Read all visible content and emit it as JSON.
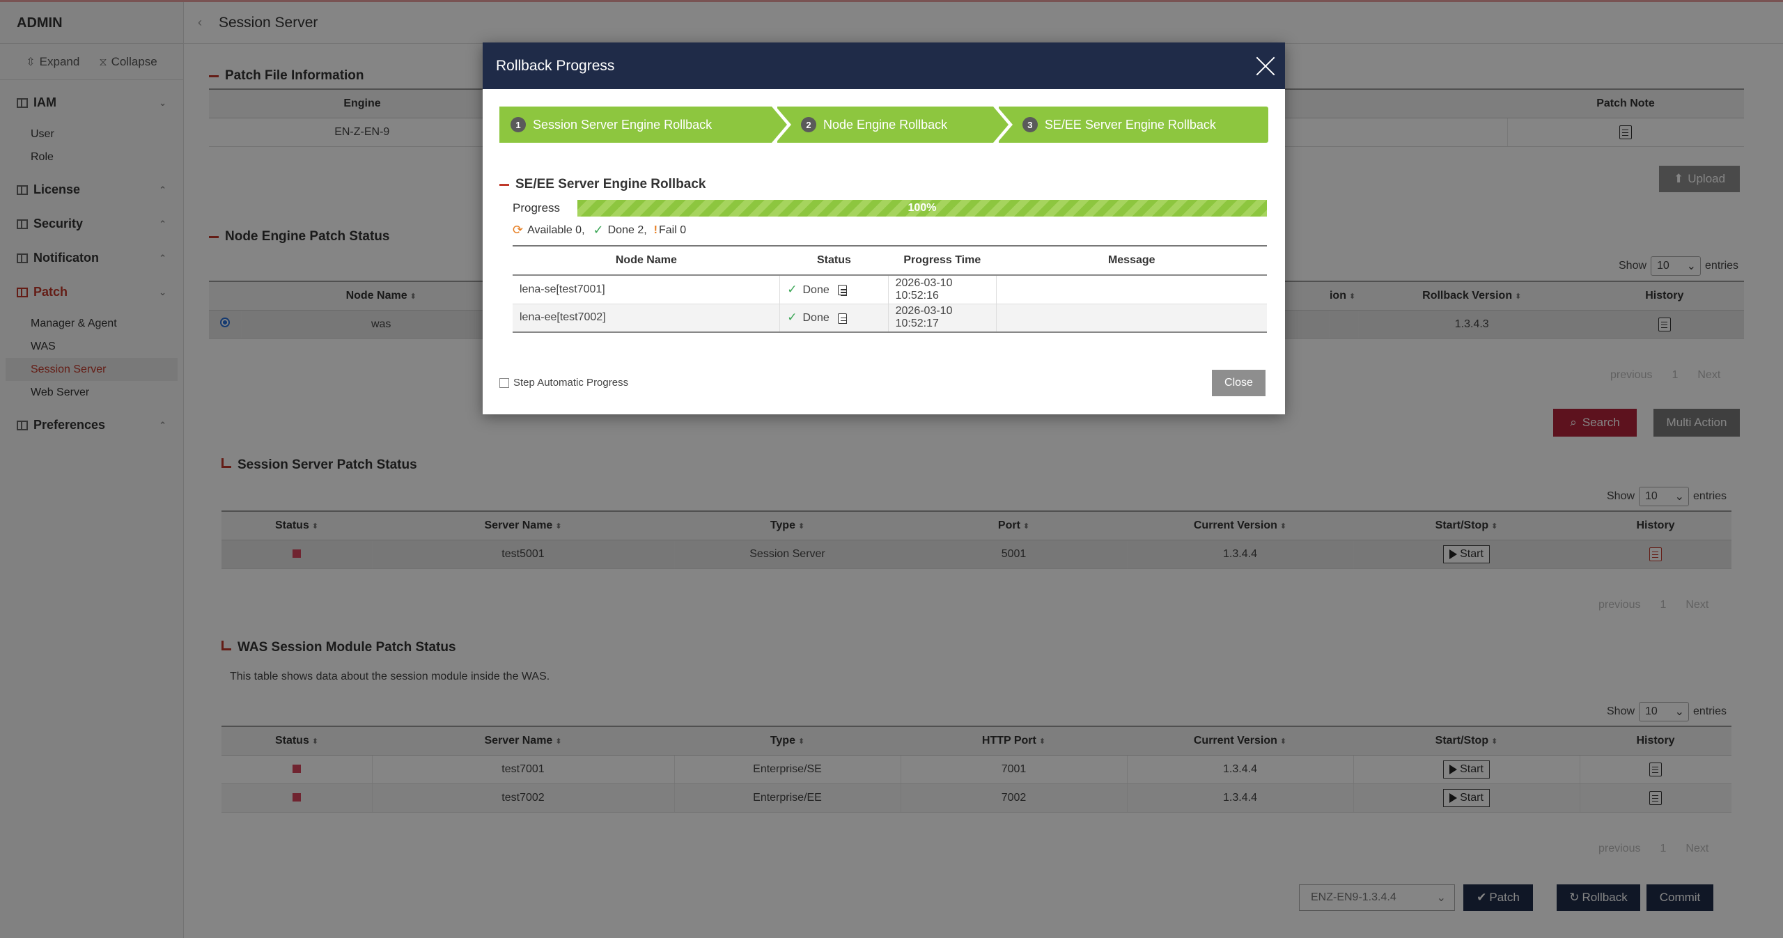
{
  "sidebar": {
    "brand": "ADMIN",
    "expand": "Expand",
    "collapse": "Collapse",
    "groups": [
      {
        "label": "IAM",
        "items": [
          "User",
          "Role"
        ]
      },
      {
        "label": "License"
      },
      {
        "label": "Security"
      },
      {
        "label": "Notificaton"
      },
      {
        "label": "Patch",
        "items": [
          "Manager & Agent",
          "WAS",
          "Session Server",
          "Web Server"
        ]
      },
      {
        "label": "Preferences"
      }
    ]
  },
  "main": {
    "title": "Session Server",
    "patch_file": {
      "title": "Patch File Information",
      "columns": [
        "Engine",
        "Patch Note"
      ],
      "row": {
        "engine": "EN-Z-EN-9"
      },
      "upload": "Upload"
    },
    "node_engine": {
      "title": "Node Engine Patch Status",
      "show": "Show",
      "entries": "entries",
      "page_size": "10",
      "columns": [
        "Node Name",
        "ion",
        "Rollback Version",
        "History"
      ],
      "row": {
        "node_name": "was",
        "rollback_version": "1.3.4.3"
      },
      "pager": {
        "previous": "previous",
        "page": "1",
        "next": "Next"
      },
      "search": "Search",
      "multi_action": "Multi Action"
    },
    "session_server": {
      "title": "Session Server Patch Status",
      "show": "Show",
      "entries": "entries",
      "page_size": "10",
      "columns": [
        "Status",
        "Server Name",
        "Type",
        "Port",
        "Current Version",
        "Start/Stop",
        "History"
      ],
      "rows": [
        {
          "server": "test5001",
          "type": "Session Server",
          "port": "5001",
          "version": "1.3.4.4",
          "action": "Start"
        }
      ],
      "pager": {
        "previous": "previous",
        "page": "1",
        "next": "Next"
      }
    },
    "was_module": {
      "title": "WAS Session Module Patch Status",
      "description": "This table shows data about the session module inside the WAS.",
      "show": "Show",
      "entries": "entries",
      "page_size": "10",
      "columns": [
        "Status",
        "Server Name",
        "Type",
        "HTTP Port",
        "Current Version",
        "Start/Stop",
        "History"
      ],
      "rows": [
        {
          "server": "test7001",
          "type": "Enterprise/SE",
          "port": "7001",
          "version": "1.3.4.4",
          "action": "Start"
        },
        {
          "server": "test7002",
          "type": "Enterprise/EE",
          "port": "7002",
          "version": "1.3.4.4",
          "action": "Start"
        }
      ],
      "pager": {
        "previous": "previous",
        "page": "1",
        "next": "Next"
      }
    },
    "footer": {
      "selected_version": "ENZ-EN9-1.3.4.4",
      "patch": "Patch",
      "rollback": "Rollback",
      "commit": "Commit"
    }
  },
  "modal": {
    "title": "Rollback Progress",
    "steps": [
      {
        "num": "1",
        "label": "Session Server Engine Rollback"
      },
      {
        "num": "2",
        "label": "Node Engine Rollback"
      },
      {
        "num": "3",
        "label": "SE/EE Server Engine Rollback"
      }
    ],
    "section": "SE/EE Server Engine Rollback",
    "progress_label": "Progress",
    "progress_value": "100%",
    "progress_fraction": 1.0,
    "counts": {
      "available": "Available 0,",
      "done": "Done 2,",
      "fail": "Fail 0"
    },
    "columns": [
      "Node Name",
      "Status",
      "Progress Time",
      "Message"
    ],
    "rows": [
      {
        "node": "lena-se[test7001]",
        "status": "Done",
        "time": "2026-03-10 10:52:16",
        "message": ""
      },
      {
        "node": "lena-ee[test7002]",
        "status": "Done",
        "time": "2026-03-10 10:52:17",
        "message": ""
      }
    ],
    "step_auto": "Step Automatic Progress",
    "close": "Close"
  },
  "colors": {
    "accent_red": "#c0392b",
    "navy": "#1f2b48",
    "step_green": "#8dc63f"
  }
}
